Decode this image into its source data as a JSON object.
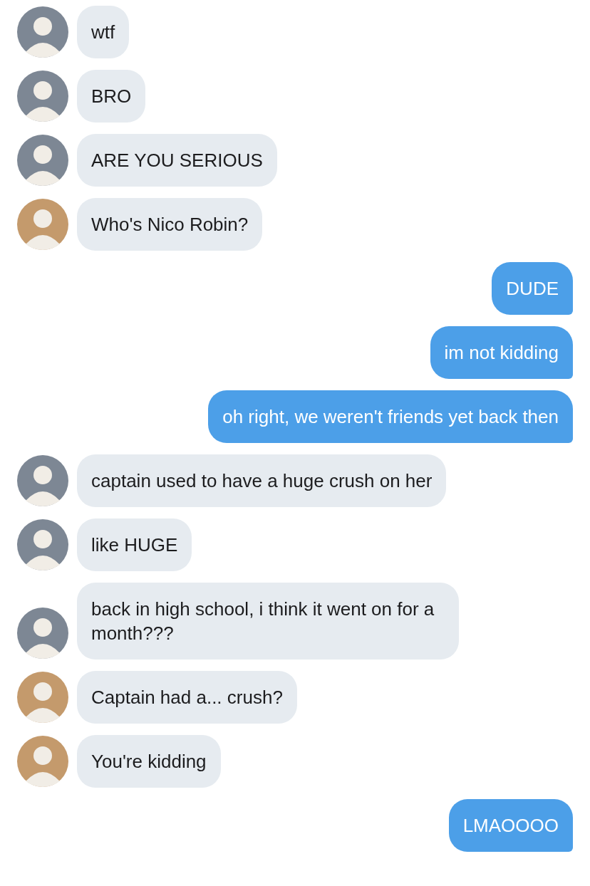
{
  "messages": [
    {
      "kind": "incoming",
      "color": "#7d8794",
      "text": "wtf"
    },
    {
      "kind": "incoming",
      "color": "#7d8794",
      "text": "BRO"
    },
    {
      "kind": "incoming",
      "color": "#7d8794",
      "text": "ARE YOU SERIOUS"
    },
    {
      "kind": "incoming",
      "color": "#c49a6c",
      "text": "Who's Nico Robin?"
    },
    {
      "kind": "outgoing",
      "text": "DUDE"
    },
    {
      "kind": "outgoing",
      "text": "im not kidding"
    },
    {
      "kind": "outgoing",
      "text": "oh right, we weren't friends yet back then"
    },
    {
      "kind": "incoming",
      "color": "#7d8794",
      "text": "captain used to have a huge crush on her"
    },
    {
      "kind": "incoming",
      "color": "#7d8794",
      "text": "like HUGE"
    },
    {
      "kind": "incoming",
      "color": "#7d8794",
      "text": "back in high school, i think it went on for a month???"
    },
    {
      "kind": "incoming",
      "color": "#c49a6c",
      "text": "Captain had a... crush?"
    },
    {
      "kind": "incoming",
      "color": "#c49a6c",
      "text": "You're kidding"
    },
    {
      "kind": "outgoing",
      "text": "LMAOOOO"
    }
  ]
}
